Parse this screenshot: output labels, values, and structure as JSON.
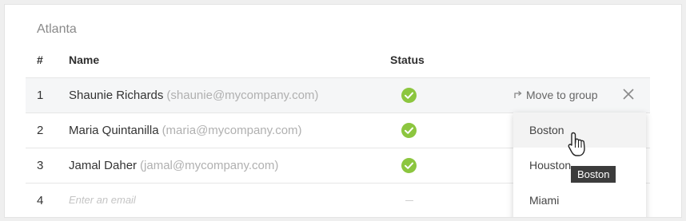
{
  "group": {
    "title": "Atlanta"
  },
  "columns": {
    "number": "#",
    "name": "Name",
    "status": "Status"
  },
  "rows": [
    {
      "number": "1",
      "name": "Shaunie Richards",
      "email": "(shaunie@mycompany.com)",
      "status": "ok"
    },
    {
      "number": "2",
      "name": "Maria Quintanilla",
      "email": "(maria@mycompany.com)",
      "status": "ok"
    },
    {
      "number": "3",
      "name": "Jamal Daher",
      "email": "(jamal@mycompany.com)",
      "status": "ok"
    },
    {
      "number": "4",
      "placeholder": "Enter an email",
      "status": "—"
    }
  ],
  "row_actions": {
    "move_label": "Move to group",
    "move_icon": "forward-arrow-icon",
    "close_icon": "close-icon"
  },
  "dropdown": {
    "options": [
      "Boston",
      "Houston",
      "Miami"
    ],
    "hovered": "Boston"
  },
  "tooltip": {
    "text": "Boston"
  },
  "colors": {
    "status_ok": "#8cc63f",
    "tooltip_bg": "#3c3c3c",
    "row_highlight": "#f5f6f7"
  }
}
